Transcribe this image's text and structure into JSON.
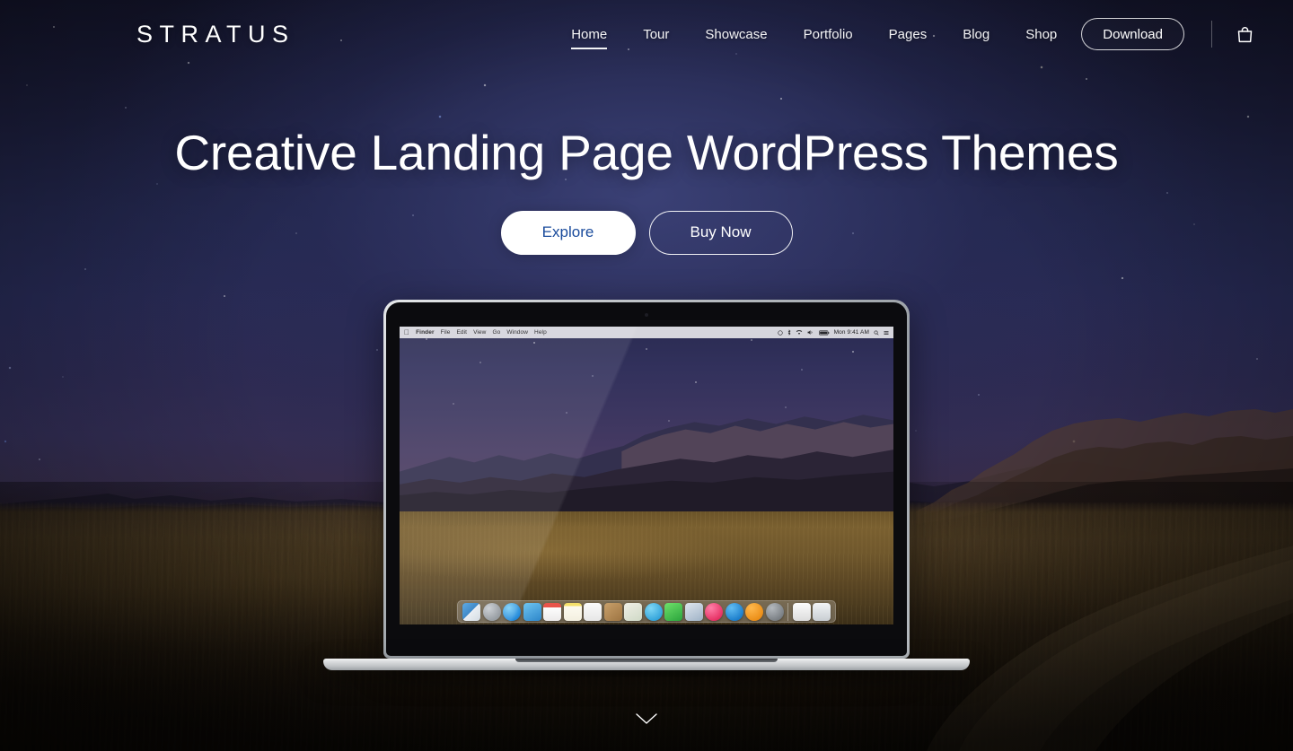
{
  "brand": {
    "logo": "STRATUS"
  },
  "nav": {
    "items": [
      {
        "label": "Home",
        "active": true
      },
      {
        "label": "Tour",
        "active": false
      },
      {
        "label": "Showcase",
        "active": false
      },
      {
        "label": "Portfolio",
        "active": false
      },
      {
        "label": "Pages",
        "active": false
      },
      {
        "label": "Blog",
        "active": false
      },
      {
        "label": "Shop",
        "active": false
      }
    ],
    "download_label": "Download",
    "cart_icon": "shopping-bag-icon"
  },
  "hero": {
    "headline": "Creative Landing Page WordPress Themes",
    "primary_cta": "Explore",
    "secondary_cta": "Buy Now",
    "scroll_icon": "chevron-down-icon"
  },
  "device": {
    "type": "laptop-mockup",
    "menubar": {
      "apple_icon": "apple-logo-icon",
      "app": "Finder",
      "menus": [
        "File",
        "Edit",
        "View",
        "Go",
        "Window",
        "Help"
      ],
      "status_icons": [
        "time-machine-icon",
        "bluetooth-icon",
        "wifi-icon",
        "volume-icon",
        "battery-icon"
      ],
      "clock": "Mon 9:41 AM",
      "right_icons": [
        "search-icon",
        "control-center-icon"
      ]
    },
    "dock": {
      "items": [
        "Finder",
        "Launchpad",
        "Safari",
        "Mail",
        "Calendar",
        "Notes",
        "Reminders",
        "Contacts",
        "Maps",
        "Messages",
        "FaceTime",
        "Photos",
        "iTunes",
        "App Store",
        "iBooks",
        "System Preferences"
      ],
      "trash_items": [
        "Downloads",
        "Trash"
      ]
    }
  },
  "colors": {
    "sky_top": "#14152c",
    "sky_mid": "#272a55",
    "field": "#58452a",
    "accent_blue": "#1a4b9c",
    "white": "#ffffff"
  }
}
